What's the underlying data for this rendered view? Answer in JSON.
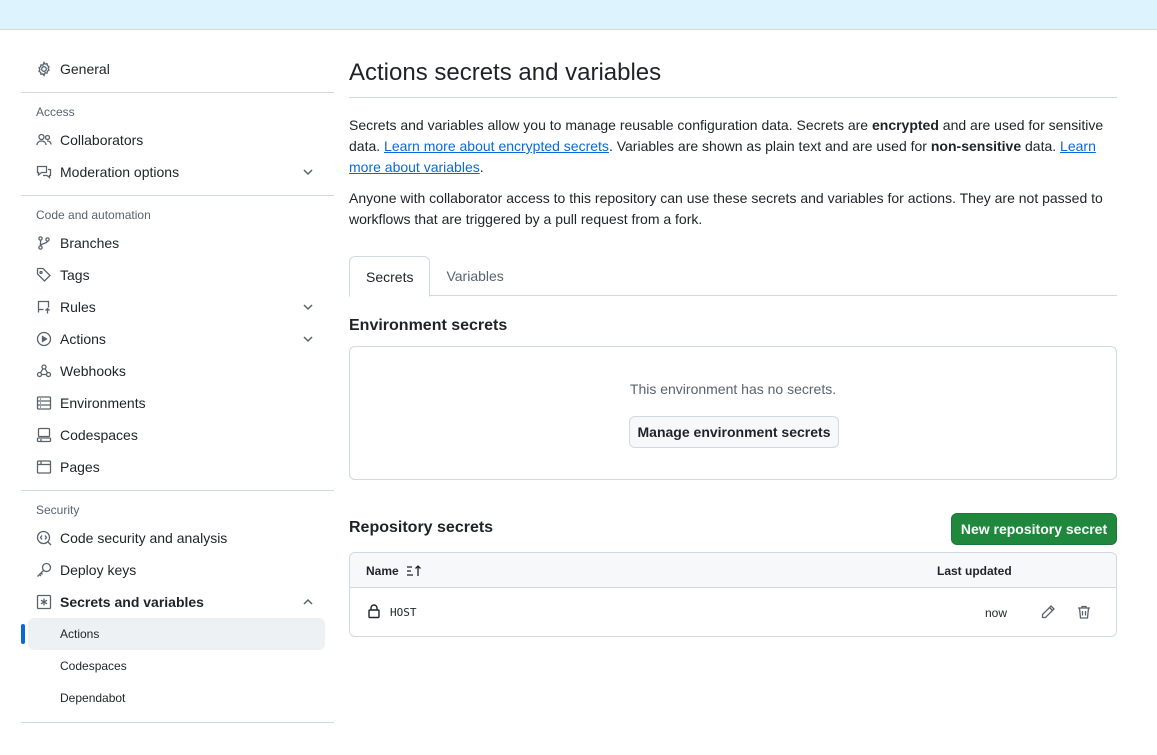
{
  "sidebar": {
    "general": "General",
    "access_header": "Access",
    "collaborators": "Collaborators",
    "moderation": "Moderation options",
    "code_header": "Code and automation",
    "branches": "Branches",
    "tags": "Tags",
    "rules": "Rules",
    "actions": "Actions",
    "webhooks": "Webhooks",
    "environments": "Environments",
    "codespaces": "Codespaces",
    "pages": "Pages",
    "security_header": "Security",
    "code_security": "Code security and analysis",
    "deploy_keys": "Deploy keys",
    "secrets_vars": "Secrets and variables",
    "sub_actions": "Actions",
    "sub_codespaces": "Codespaces",
    "sub_dependabot": "Dependabot"
  },
  "main": {
    "title": "Actions secrets and variables",
    "intro_1": "Secrets and variables allow you to manage reusable configuration data. Secrets are ",
    "intro_encrypted": "encrypted",
    "intro_2": " and are used for sensitive data. ",
    "intro_link_secrets": "Learn more about encrypted secrets",
    "intro_3": ". Variables are shown as plain text and are used for ",
    "intro_nonsensitive": "non-sensitive",
    "intro_4": " data. ",
    "intro_link_variables": "Learn more about variables",
    "intro_5": ".",
    "access_note": "Anyone with collaborator access to this repository can use these secrets and variables for actions. They are not passed to workflows that are triggered by a pull request from a fork.",
    "tabs": [
      "Secrets",
      "Variables"
    ],
    "env_heading": "Environment secrets",
    "env_empty": "This environment has no secrets.",
    "env_button": "Manage environment secrets",
    "repo_heading": "Repository secrets",
    "repo_button": "New repository secret",
    "table": {
      "col_name": "Name",
      "col_updated": "Last updated",
      "rows": [
        {
          "name": "HOST",
          "updated": "now"
        }
      ]
    }
  }
}
